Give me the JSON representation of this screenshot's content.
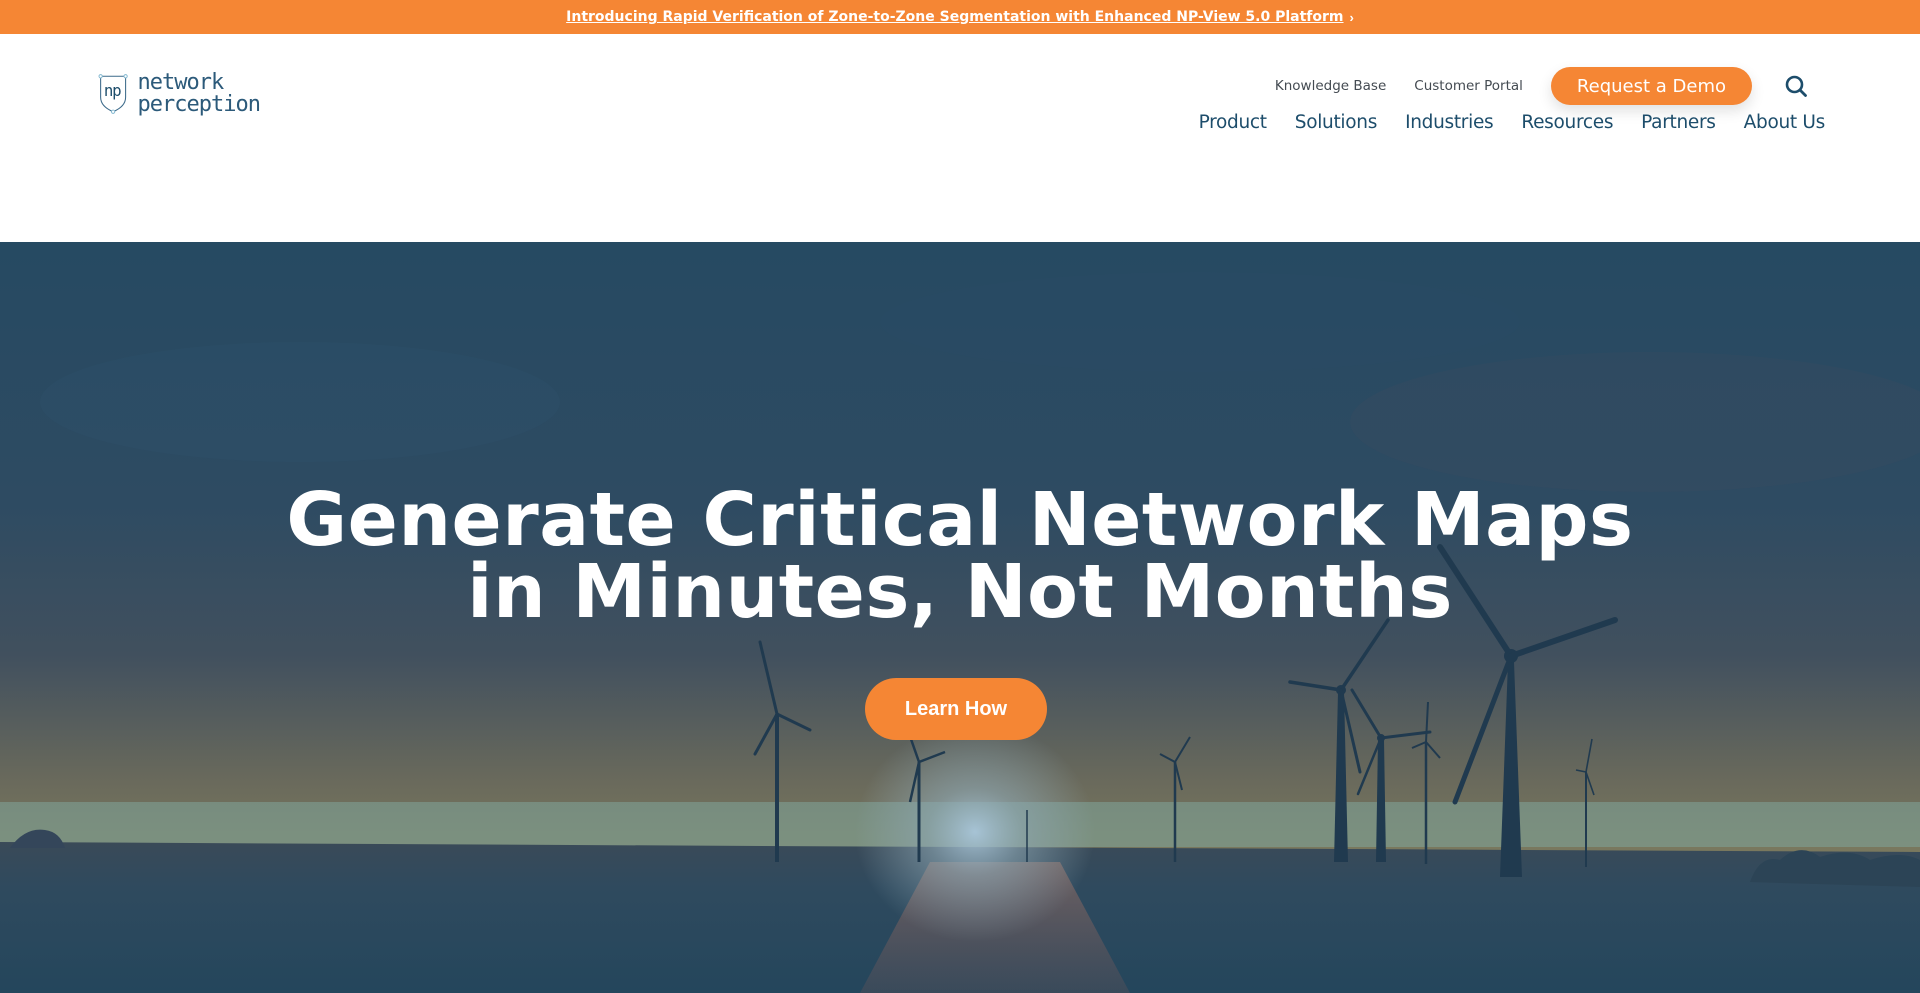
{
  "announcement": {
    "text": "Introducing Rapid Verification of Zone-to-Zone Segmentation with Enhanced NP-View 5.0 Platform",
    "chevron": "›"
  },
  "header": {
    "logo": {
      "mark": "np",
      "line1": "network",
      "line2": "perception"
    },
    "utility_links": [
      {
        "label": "Knowledge Base"
      },
      {
        "label": "Customer Portal"
      }
    ],
    "demo_button": "Request a Demo",
    "search_icon": "search-icon",
    "nav": [
      {
        "label": "Product"
      },
      {
        "label": "Solutions"
      },
      {
        "label": "Industries"
      },
      {
        "label": "Resources"
      },
      {
        "label": "Partners"
      },
      {
        "label": "About Us"
      }
    ]
  },
  "hero": {
    "title_line1": "Generate Critical Network Maps",
    "title_line2": "in Minutes, Not Months",
    "cta": "Learn How",
    "background": "wind-turbines-sunset"
  },
  "colors": {
    "accent": "#f58634",
    "brand_navy": "#1d4d6b",
    "hero_overlay": "#244a63"
  }
}
